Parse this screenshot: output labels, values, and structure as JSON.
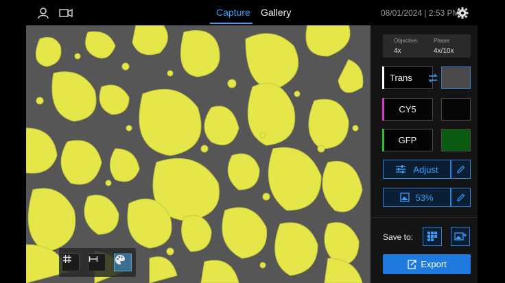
{
  "header": {
    "tabs": [
      {
        "label": "Capture",
        "active": true
      },
      {
        "label": "Gallery",
        "active": false
      }
    ],
    "datetime": "08/01/2024 | 2:53 PM"
  },
  "panel": {
    "objective": {
      "label": "Objective:",
      "value": "4x"
    },
    "phase": {
      "label": "Phase:",
      "value": "4x/10x"
    },
    "channels": [
      {
        "label": "Trans",
        "color": "#ffffff"
      },
      {
        "label": "CY5",
        "color": "#d23cc8"
      },
      {
        "label": "GFP",
        "color": "#29c23a"
      }
    ],
    "adjust_label": "Adjust",
    "percent_label": "53%",
    "save_label": "Save to:",
    "export_label": "Export"
  },
  "colors": {
    "accent": "#3aa0ff",
    "overlay": "#e6e84a",
    "button": "#1f7ae0"
  },
  "icons": [
    "user-icon",
    "camera-icon",
    "gear-icon",
    "swap-icon",
    "sliders-icon",
    "pencil-icon",
    "image-icon",
    "grid-icon",
    "ruler-icon",
    "palette-icon",
    "export-icon"
  ]
}
